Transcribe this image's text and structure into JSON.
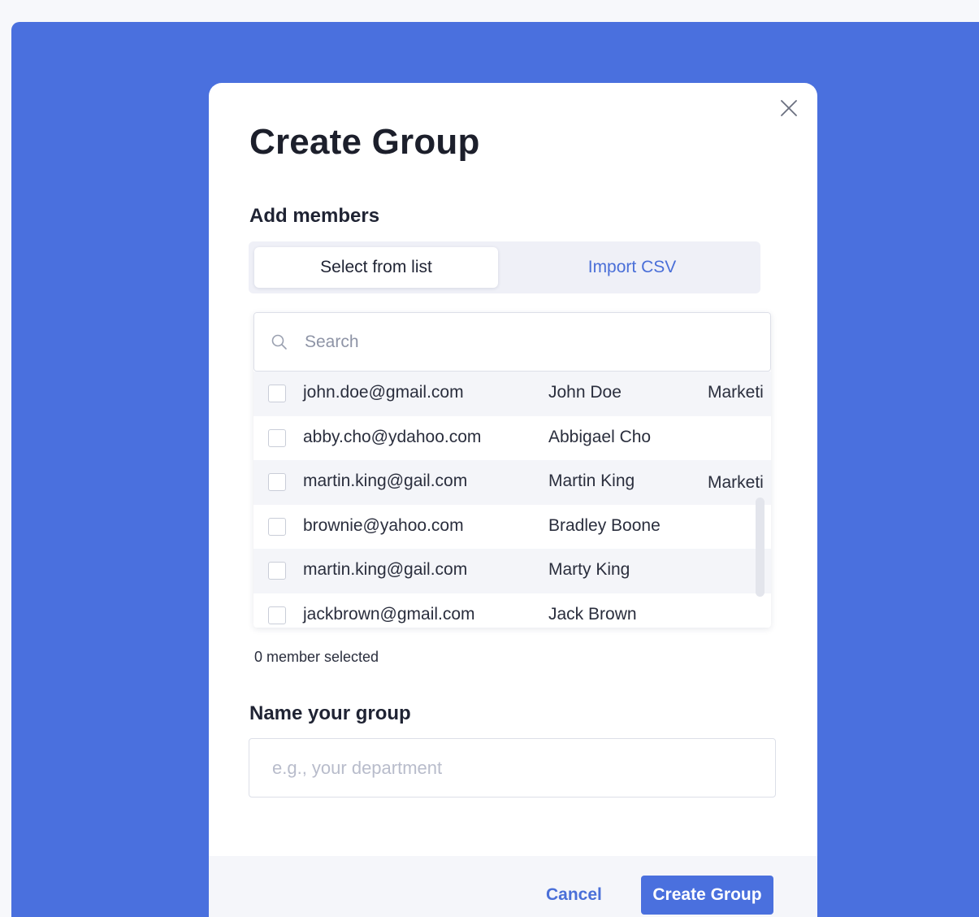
{
  "modal": {
    "title": "Create Group",
    "add_members_label": "Add members",
    "tabs": [
      {
        "label": "Select from list",
        "active": true
      },
      {
        "label": "Import CSV",
        "active": false
      }
    ],
    "search": {
      "placeholder": "Search",
      "value": "",
      "icon": "search-icon"
    },
    "members": [
      {
        "email": "john.doe@gmail.com",
        "name": "John Doe",
        "dept": "Marketi",
        "checked": false
      },
      {
        "email": "abby.cho@ydahoo.com",
        "name": "Abbigael Cho",
        "dept": "",
        "checked": false
      },
      {
        "email": "martin.king@gail.com",
        "name": "Martin King",
        "dept": "Marketi",
        "checked": false
      },
      {
        "email": "brownie@yahoo.com",
        "name": "Bradley Boone",
        "dept": "",
        "checked": false
      },
      {
        "email": "martin.king@gail.com",
        "name": "Marty King",
        "dept": "",
        "checked": false
      },
      {
        "email": "jackbrown@gmail.com",
        "name": "Jack Brown",
        "dept": "",
        "checked": false
      }
    ],
    "selected_count_text": "0 member selected",
    "group_name_label": "Name your group",
    "group_name": {
      "placeholder": "e.g., your department",
      "value": ""
    },
    "footer": {
      "cancel_label": "Cancel",
      "create_label": "Create Group"
    },
    "close_icon": "close-icon"
  },
  "colors": {
    "backdrop": "#4a70de",
    "accent": "#4a6fd8",
    "primary_button": "#4a70de"
  }
}
